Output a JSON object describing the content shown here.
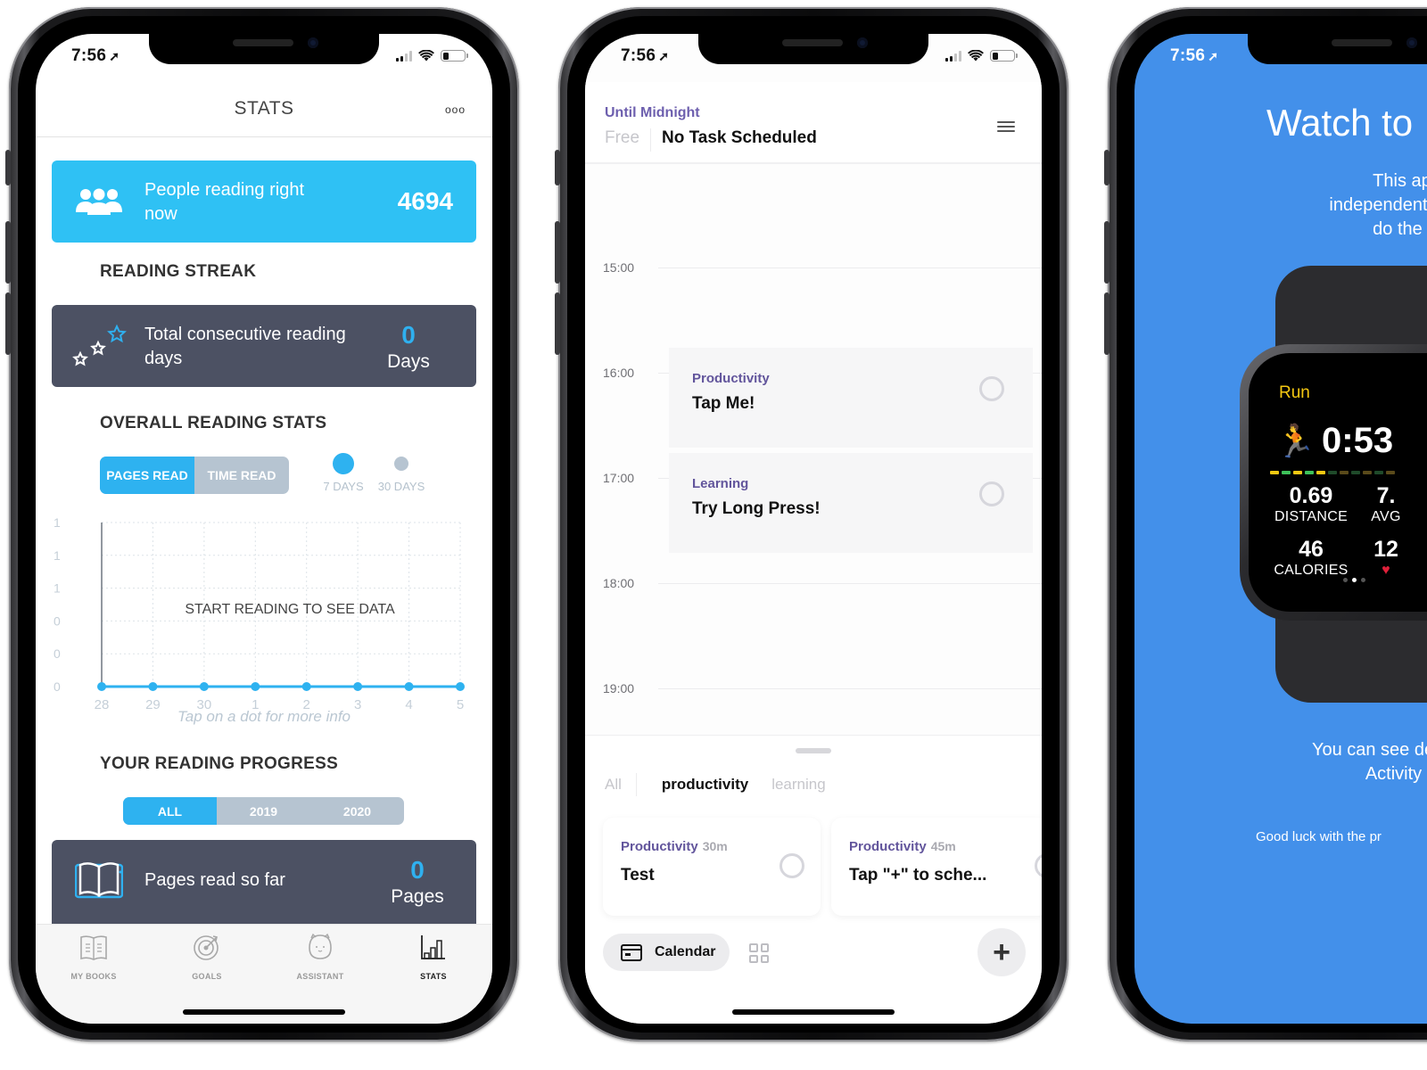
{
  "status_bar": {
    "time": "7:56",
    "location_icon": "location-arrow-icon"
  },
  "stats_screen": {
    "title": "STATS",
    "more_icon": "ooo",
    "people_reading": {
      "label": "People reading right now",
      "count": "4694",
      "icon": "people-icon"
    },
    "reading_streak": {
      "heading": "READING STREAK",
      "label": "Total consecutive reading days",
      "value": "0",
      "unit": "Days",
      "icon": "stars-icon"
    },
    "overall_stats": {
      "heading": "OVERALL READING STATS",
      "metric_tabs": [
        {
          "label": "PAGES READ",
          "active": true
        },
        {
          "label": "TIME READ",
          "active": false
        }
      ],
      "range_options": [
        {
          "label": "7 DAYS",
          "active": true
        },
        {
          "label": "30 DAYS",
          "active": false
        }
      ],
      "hint": "Tap on a dot for more info"
    },
    "reading_progress": {
      "heading": "YOUR READING PROGRESS",
      "year_tabs": [
        {
          "label": "ALL",
          "active": true
        },
        {
          "label": "2019",
          "active": false
        },
        {
          "label": "2020",
          "active": false
        }
      ],
      "label": "Pages read so far",
      "value": "0",
      "unit": "Pages",
      "icon": "open-book-icon"
    },
    "tab_bar": [
      {
        "label": "MY BOOKS",
        "icon": "books-icon",
        "active": false
      },
      {
        "label": "GOALS",
        "icon": "target-icon",
        "active": false
      },
      {
        "label": "ASSISTANT",
        "icon": "assistant-icon",
        "active": false
      },
      {
        "label": "STATS",
        "icon": "stats-icon",
        "active": true
      }
    ],
    "colors": {
      "accent": "#2fc1f4",
      "card_dark": "#4c5163",
      "inactive_tab": "#b6c4d1"
    }
  },
  "chart_data": {
    "type": "line",
    "title": "",
    "overlay_text": "START READING TO SEE DATA",
    "xlabel": "",
    "ylabel": "",
    "categories": [
      "28",
      "29",
      "30",
      "1",
      "2",
      "3",
      "4",
      "5"
    ],
    "series": [
      {
        "name": "Pages read",
        "values": [
          0,
          0,
          0,
          0,
          0,
          0,
          0,
          0
        ]
      }
    ],
    "y_tick_labels": [
      "0",
      "0",
      "0",
      "1",
      "1",
      "1"
    ],
    "ylim": [
      0,
      1
    ],
    "grid": true,
    "legend": "none"
  },
  "calendar_screen": {
    "until_label": "Until Midnight",
    "free_label": "Free",
    "status": "No Task Scheduled",
    "menu_icon": "hamburger-icon",
    "hours": [
      "15:00",
      "16:00",
      "17:00",
      "18:00",
      "19:00"
    ],
    "scheduled_tasks": [
      {
        "category": "Productivity",
        "name": "Tap Me!",
        "hour": "16:00"
      },
      {
        "category": "Learning",
        "name": "Try Long Press!",
        "hour": "17:00"
      }
    ],
    "filters": [
      {
        "label": "All",
        "active": false
      },
      {
        "label": "productivity",
        "active": true
      },
      {
        "label": "learning",
        "active": false
      }
    ],
    "task_cards": [
      {
        "category": "Productivity",
        "duration": "30m",
        "name": "Test"
      },
      {
        "category": "Productivity",
        "duration": "45m",
        "name": "Tap \"+\" to sche..."
      }
    ],
    "calendar_button": "Calendar",
    "add_button": "+",
    "colors": {
      "category": "#62559c"
    }
  },
  "watch_screen": {
    "title": "Watch to",
    "intro_lines": [
      "This app is purposely d",
      "independent Watch Applicat",
      "do the program entirely"
    ],
    "watch_face": {
      "activity": "Run",
      "elapsed": "0:53",
      "metrics": [
        {
          "value": "0.69",
          "label": "DISTANCE"
        },
        {
          "value": "7.",
          "label": "AVG"
        },
        {
          "value": "46",
          "label": "CALORIES"
        },
        {
          "value": "12",
          "label": "♥"
        }
      ]
    },
    "details_lines": [
      "You can see details of your p",
      "Activity application on"
    ],
    "farewell": "Good luck with the pr",
    "colors": {
      "background": "#4390ea",
      "run_label": "#f5c812"
    }
  }
}
